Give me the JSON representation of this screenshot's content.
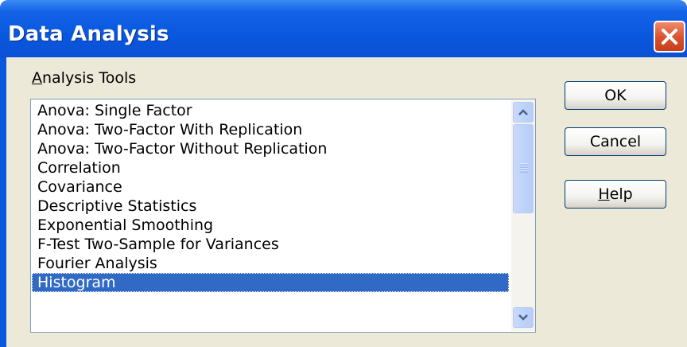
{
  "dialog": {
    "title": "Data Analysis",
    "tools_label_accel": "A",
    "tools_label_rest": "nalysis Tools"
  },
  "list": {
    "items": [
      "Anova: Single Factor",
      "Anova: Two-Factor With Replication",
      "Anova: Two-Factor Without Replication",
      "Correlation",
      "Covariance",
      "Descriptive Statistics",
      "Exponential Smoothing",
      "F-Test Two-Sample for Variances",
      "Fourier Analysis",
      "Histogram"
    ],
    "selected": "Histogram"
  },
  "buttons": {
    "ok": "OK",
    "cancel": "Cancel",
    "help_accel": "H",
    "help_rest": "elp"
  },
  "icons": {
    "close": "close-icon",
    "scroll_up": "chevron-up-icon",
    "scroll_down": "chevron-down-icon",
    "scroll_grip": "grip-icon"
  },
  "colors": {
    "title_bar": "#0a56dc",
    "close_button": "#d9502b",
    "client_background": "#ece9d8",
    "selection": "#316ac5",
    "scrollbar": "#b6cdf8"
  }
}
